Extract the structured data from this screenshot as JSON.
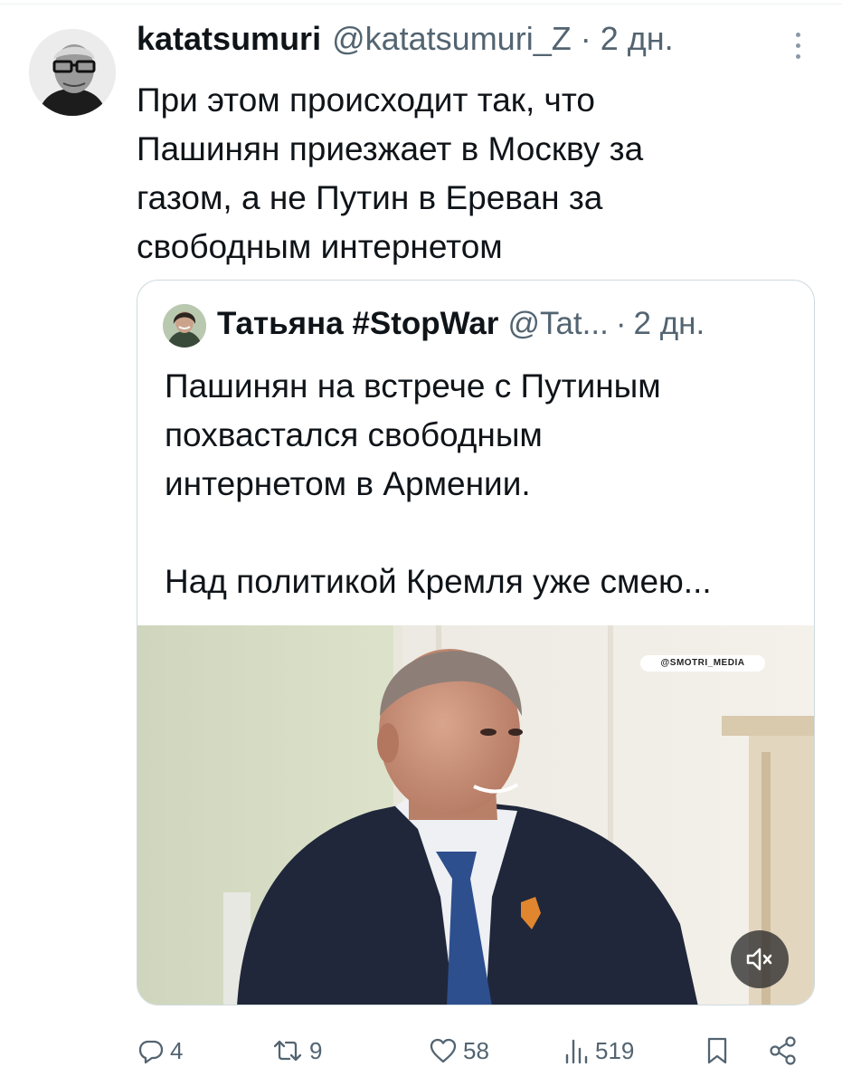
{
  "tweet": {
    "author_name": "katatsumuri",
    "author_handle": "@katatsumuri_Z",
    "separator": "·",
    "timestamp": "2 дн.",
    "text_lines": [
      "При этом происходит так, что",
      "Пашинян приезжает в Москву за",
      "газом, а не Путин в Ереван за",
      "свободным интернетом"
    ]
  },
  "quote": {
    "author_name": "Татьяна #StopWar",
    "author_handle": "@Tat...",
    "separator": "·",
    "timestamp": "2 дн.",
    "text_lines": [
      "Пашинян на встрече с Путиным",
      "похвастался свободным",
      "интернетом в Армении.",
      "",
      "Над политикой Кремля уже смею..."
    ],
    "media": {
      "watermark": "@SMOTRI_MEDIA",
      "mute_icon": "speaker-muted-icon"
    }
  },
  "actions": {
    "replies": "4",
    "reposts": "9",
    "likes": "58",
    "views": "519",
    "icons": [
      "reply-icon",
      "repost-icon",
      "like-icon",
      "views-icon",
      "bookmark-icon",
      "share-icon"
    ]
  },
  "colors": {
    "text": "#0f1419",
    "secondary": "#536471",
    "border": "#cfd9de"
  }
}
